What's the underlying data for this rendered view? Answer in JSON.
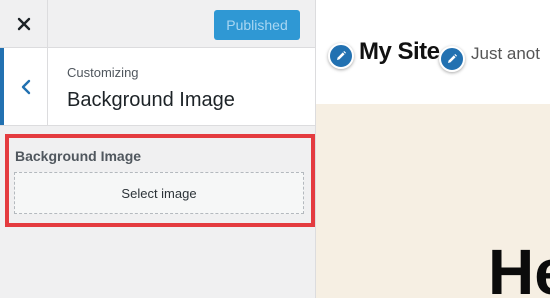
{
  "topbar": {
    "close_icon": "close-icon",
    "publish_label": "Published"
  },
  "section": {
    "back_icon": "chevron-left-icon",
    "breadcrumb": "Customizing",
    "title": "Background Image"
  },
  "control": {
    "label": "Background Image",
    "button_label": "Select image"
  },
  "preview": {
    "site_title": "My Site",
    "tagline": "Just anot",
    "heading_partial": "He",
    "edit_icon": "pencil-icon"
  },
  "colors": {
    "accent": "#2271b1",
    "publish_button": "#2f98d4",
    "highlight": "#e43b3f",
    "preview_background": "#f6efe3"
  }
}
